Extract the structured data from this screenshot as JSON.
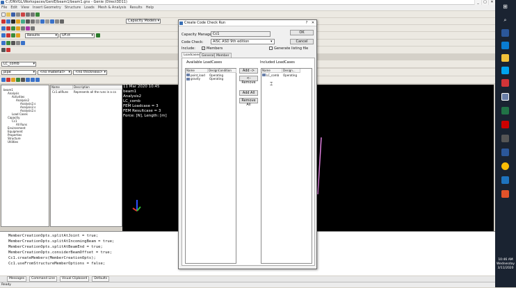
{
  "window": {
    "title": "C:/DNVGL/Workspaces/GeniE/beam1/beam1.gnx - Genie (Direct3D11)",
    "controls": [
      "_",
      "▢",
      "✕"
    ]
  },
  "menu": [
    "File",
    "Edit",
    "View",
    "Insert Geometry",
    "Structure",
    "Loads",
    "Mesh & Analysis",
    "Results",
    "Help"
  ],
  "toolbars": {
    "results_combo": "Results",
    "uf_combo": "UF.ct",
    "capacity_models_combo": "Capacity Models",
    "lc_combo": "LC_comb",
    "section_combo": "pipe",
    "material_combo": "<no material>",
    "thickness_combo": "<no thickness>"
  },
  "tree": {
    "items": [
      "beam1",
      "Analysis",
      "Activities",
      "Analysis2",
      "Analysis2.s",
      "Analysis2.s",
      "Analysis2.s",
      "Load Cases",
      "Capacity",
      "Cc1",
      "All Runs",
      "Environment",
      "Equipment",
      "Properties",
      "Structure",
      "Utilities"
    ]
  },
  "list": {
    "headers": [
      "Name",
      "Description"
    ],
    "rows": [
      {
        "name": "Cc1.allRuns",
        "desc": "Represents all the runs in a ca"
      }
    ]
  },
  "graphics": {
    "lines": [
      "11 Mar 2020 10:45",
      "beam1",
      "Analysis2",
      "LC_comb",
      "FEM Loadcase = 3",
      "FEM Resultcase = 3",
      "Force: [N], Length: [m]"
    ]
  },
  "command_lines": [
    "MemberCreationOpts.splitAtJoint = true;",
    "MemberCreationOpts.splitAtIncomingBeam = true;",
    "MemberCreationOpts.splitAtBeamEnd = true;",
    "MemberCreationOpts.considerBeamOffset = true;",
    "Cc1.createMembers(MemberCreationOpts);",
    "Cc1.useFromStructureMemberOptions = false;"
  ],
  "bottom_tabs": [
    "Messages",
    "Command Line",
    "Visual Clipboard",
    "Defaults"
  ],
  "status": "Ready",
  "dialog": {
    "title": "Create Code Check Run",
    "help": "?",
    "close": "✕",
    "capacity_manager_label": "Capacity Manager:",
    "capacity_manager_value": "Cc1",
    "code_check_label": "Code Check:",
    "code_check_value": "AISC ASD 9th edition",
    "include_label": "Include:",
    "members_label": "Members",
    "members_checked": true,
    "generate_listing_label": "Generate listing file",
    "generate_listing_checked": false,
    "ok": "OK",
    "cancel": "Cancel",
    "tabs": [
      "Loadcases",
      "General",
      "Member"
    ],
    "available_label": "Available LoadCases",
    "included_label": "Included LoadCases",
    "available_headers": [
      "Name",
      "DesignCondition"
    ],
    "available_rows": [
      {
        "name": "point_load",
        "cond": "Operating"
      },
      {
        "name": "gravity",
        "cond": "Operating"
      }
    ],
    "included_headers": [
      "Name",
      "Design..."
    ],
    "included_rows": [
      {
        "name": "LC_comb",
        "cond": "Operating"
      }
    ],
    "add_btn": "Add ->",
    "remove_btn": "<- Remove",
    "add_all_btn": "Add All",
    "remove_all_btn": "Remove All"
  },
  "clock": {
    "time": "10:46 AM",
    "day": "Wednesday",
    "date": "3/11/2020"
  }
}
